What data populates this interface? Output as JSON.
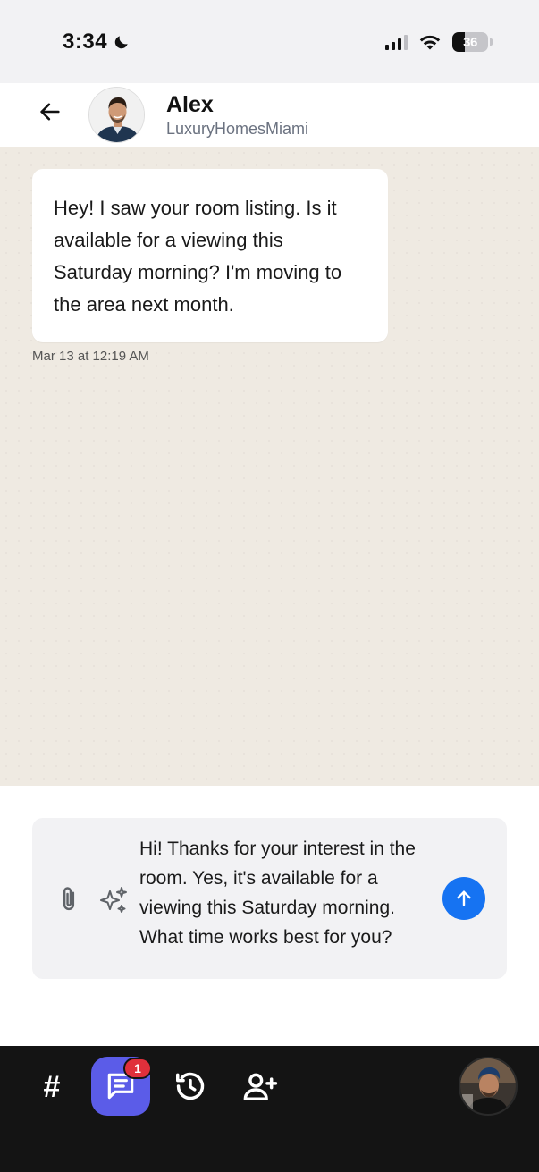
{
  "status_bar": {
    "time": "3:34",
    "battery": "36",
    "battery_level": 0.36,
    "icons": [
      "moon-icon",
      "signal-icon",
      "wifi-icon",
      "battery-icon"
    ]
  },
  "header": {
    "contact_name": "Alex",
    "contact_subtitle": "LuxuryHomesMiami",
    "icons": [
      "back-arrow-icon",
      "avatar"
    ]
  },
  "messages": [
    {
      "text": "Hey! I saw your room listing. Is it available for a viewing this Saturday morning? I'm moving to the area next month.",
      "timestamp": "Mar 13 at 12:19 AM",
      "direction": "incoming"
    }
  ],
  "composer": {
    "draft": "Hi! Thanks for your interest in the room. Yes, it's available for a viewing this Saturday morning. What time works best for you?",
    "icons": [
      "paperclip-icon",
      "sparkles-icon",
      "send-arrow-icon"
    ]
  },
  "bottom_nav": {
    "hash_label": "#",
    "chat_badge": "1",
    "icons": [
      "hash-icon",
      "chat-icon",
      "history-icon",
      "add-user-icon",
      "profile-avatar"
    ]
  },
  "colors": {
    "chat_background": "#efeae2",
    "send_button": "#1673f2",
    "nav_active": "#5b5ce8",
    "badge": "#e0303b",
    "nav_background": "#141414"
  }
}
